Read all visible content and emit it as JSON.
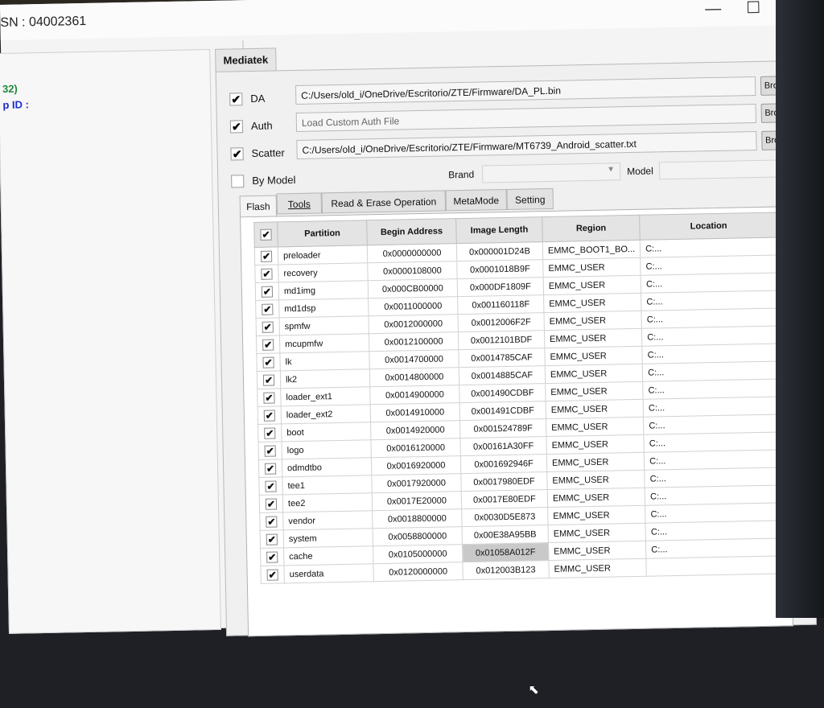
{
  "window": {
    "title": "SN : 04002361",
    "btn_minimize": "—",
    "btn_maximize": "☐",
    "btn_close": "✕"
  },
  "left_panel": {
    "line1": "32)",
    "line2": "p ID  :"
  },
  "mediatek_tab": "Mediatek",
  "da": {
    "label": "DA",
    "checked": "✔",
    "value": "C:/Users/old_i/OneDrive/Escritorio/ZTE/Firmware/DA_PL.bin",
    "browse": "Browse"
  },
  "auth": {
    "label": "Auth",
    "checked": "✔",
    "placeholder": "Load Custom Auth File",
    "browse": "Browse"
  },
  "scatter": {
    "label": "Scatter",
    "checked": "✔",
    "value": "C:/Users/old_i/OneDrive/Escritorio/ZTE/Firmware/MT6739_Android_scatter.txt",
    "browse": "Browse"
  },
  "by_model": {
    "label": "By Model",
    "brand_label": "Brand",
    "model_label": "Model"
  },
  "icons": {
    "dropdown_arrow": "▼",
    "check": "✔",
    "cursor": "⬉"
  },
  "subtabs": [
    "Flash",
    "Tools",
    "Read & Erase Operation",
    "MetaMode",
    "Setting"
  ],
  "table": {
    "headers": [
      "Partition",
      "Begin Address",
      "Image Length",
      "Region",
      "Location"
    ],
    "rows": [
      [
        "preloader",
        "0x0000000000",
        "0x000001D24B",
        "EMMC_BOOT1_BO...",
        "C:..."
      ],
      [
        "recovery",
        "0x0000108000",
        "0x0001018B9F",
        "EMMC_USER",
        "C:..."
      ],
      [
        "md1img",
        "0x000CB00000",
        "0x000DF1809F",
        "EMMC_USER",
        "C:..."
      ],
      [
        "md1dsp",
        "0x0011000000",
        "0x001160118F",
        "EMMC_USER",
        "C:..."
      ],
      [
        "spmfw",
        "0x0012000000",
        "0x0012006F2F",
        "EMMC_USER",
        "C:..."
      ],
      [
        "mcupmfw",
        "0x0012100000",
        "0x0012101BDF",
        "EMMC_USER",
        "C:..."
      ],
      [
        "lk",
        "0x0014700000",
        "0x0014785CAF",
        "EMMC_USER",
        "C:..."
      ],
      [
        "lk2",
        "0x0014800000",
        "0x0014885CAF",
        "EMMC_USER",
        "C:..."
      ],
      [
        "loader_ext1",
        "0x0014900000",
        "0x001490CDBF",
        "EMMC_USER",
        "C:..."
      ],
      [
        "loader_ext2",
        "0x0014910000",
        "0x001491CDBF",
        "EMMC_USER",
        "C:..."
      ],
      [
        "boot",
        "0x0014920000",
        "0x001524789F",
        "EMMC_USER",
        "C:..."
      ],
      [
        "logo",
        "0x0016120000",
        "0x00161A30FF",
        "EMMC_USER",
        "C:..."
      ],
      [
        "odmdtbo",
        "0x0016920000",
        "0x001692946F",
        "EMMC_USER",
        "C:..."
      ],
      [
        "tee1",
        "0x0017920000",
        "0x0017980EDF",
        "EMMC_USER",
        "C:..."
      ],
      [
        "tee2",
        "0x0017E20000",
        "0x0017E80EDF",
        "EMMC_USER",
        "C:..."
      ],
      [
        "vendor",
        "0x0018800000",
        "0x0030D5E873",
        "EMMC_USER",
        "C:..."
      ],
      [
        "system",
        "0x0058800000",
        "0x00E38A95BB",
        "EMMC_USER",
        "C:..."
      ],
      [
        "cache",
        "0x0105000000",
        "0x01058A012F",
        "EMMC_USER",
        "C:..."
      ],
      [
        "userdata",
        "0x0120000000",
        "0x012003B123",
        "EMMC_USER",
        ""
      ]
    ]
  }
}
